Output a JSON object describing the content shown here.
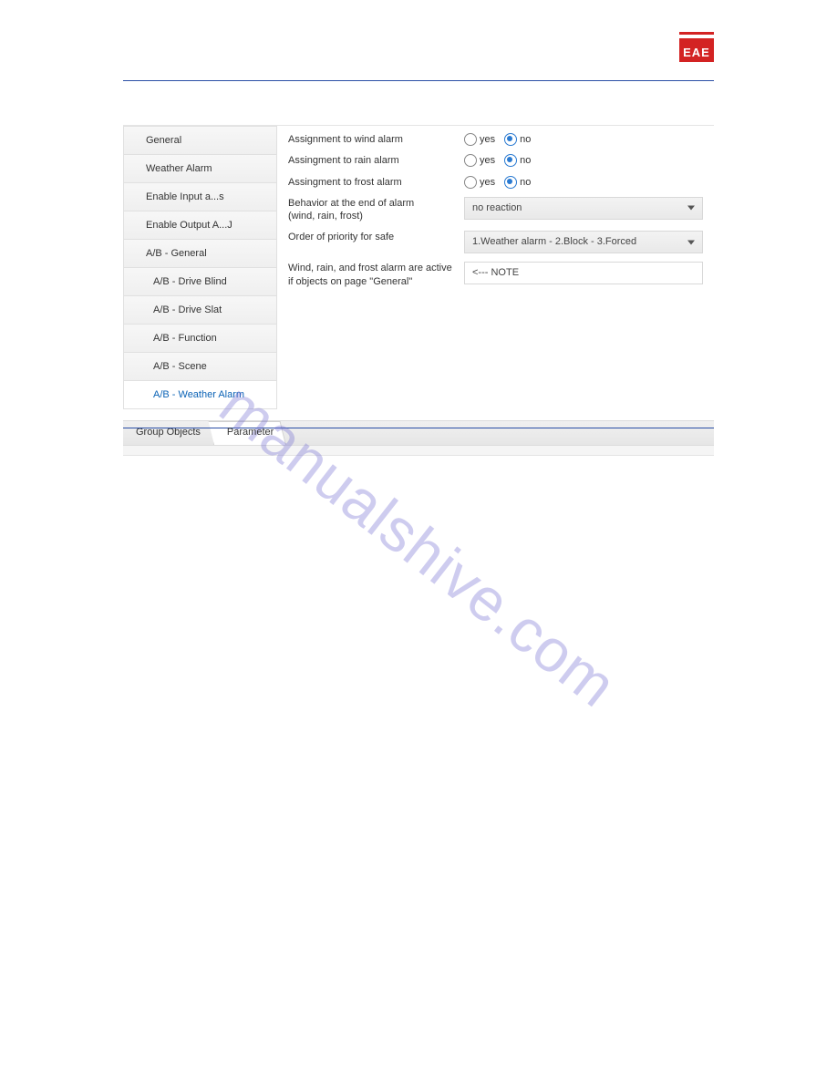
{
  "brand": {
    "text": "EAE"
  },
  "watermark": "manualshive.com",
  "sidebar": {
    "items": [
      {
        "label": "General",
        "indent": 1,
        "active": false
      },
      {
        "label": "Weather Alarm",
        "indent": 1,
        "active": false
      },
      {
        "label": "Enable Input a...s",
        "indent": 1,
        "active": false
      },
      {
        "label": "Enable Output A...J",
        "indent": 1,
        "active": false
      },
      {
        "label": "A/B - General",
        "indent": 1,
        "active": false
      },
      {
        "label": "A/B - Drive Blind",
        "indent": 2,
        "active": false
      },
      {
        "label": "A/B - Drive Slat",
        "indent": 2,
        "active": false
      },
      {
        "label": "A/B - Function",
        "indent": 2,
        "active": false
      },
      {
        "label": "A/B - Scene",
        "indent": 2,
        "active": false
      },
      {
        "label": "A/B - Weather Alarm",
        "indent": 2,
        "active": true
      }
    ]
  },
  "form": {
    "wind": {
      "label": "Assignment to wind alarm",
      "yes": "yes",
      "no": "no",
      "value": "no"
    },
    "rain": {
      "label": "Assingment to rain alarm",
      "yes": "yes",
      "no": "no",
      "value": "no"
    },
    "frost": {
      "label": "Assingment to frost alarm",
      "yes": "yes",
      "no": "no",
      "value": "no"
    },
    "behavior": {
      "label": "Behavior at the end of alarm\n(wind, rain, frost)",
      "value": "no reaction"
    },
    "priority": {
      "label": "Order of priority for safe",
      "value": "1.Weather alarm - 2.Block - 3.Forced"
    },
    "note": {
      "label": "Wind, rain, and frost alarm are active\nif objects on page \"General\"",
      "value": "<--- NOTE"
    }
  },
  "tabs": {
    "group_objects": "Group Objects",
    "parameter": "Parameter"
  }
}
